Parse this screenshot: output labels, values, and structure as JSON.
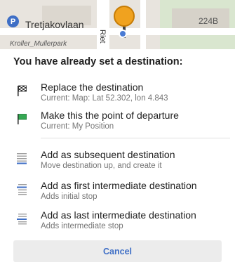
{
  "map": {
    "street_label": "Tretjakovlaan",
    "house_number": "224B",
    "area_label": "Kroller_Mullerpark",
    "side_street": "Riet",
    "parking_symbol": "P"
  },
  "dialog": {
    "title": "You have already set a destination:",
    "items": [
      {
        "icon": "checkered-flag-icon",
        "label": "Replace the destination",
        "sub": "Current: Map: Lat 52.302, lon 4.843"
      },
      {
        "icon": "green-flag-icon",
        "label": "Make this the point of departure",
        "sub": "Current: My Position"
      },
      {
        "icon": "subsequent-destination-icon",
        "label": "Add as subsequent destination",
        "sub": "Move destination up, and create it"
      },
      {
        "icon": "first-intermediate-icon",
        "label": "Add as first intermediate destination",
        "sub": "Adds initial stop"
      },
      {
        "icon": "last-intermediate-icon",
        "label": "Add as last intermediate destination",
        "sub": "Adds intermediate stop"
      }
    ],
    "cancel_label": "Cancel"
  },
  "colors": {
    "accent": "#3f6fc6",
    "flag_green": "#34a853",
    "pin_orange": "#f0a21f"
  }
}
